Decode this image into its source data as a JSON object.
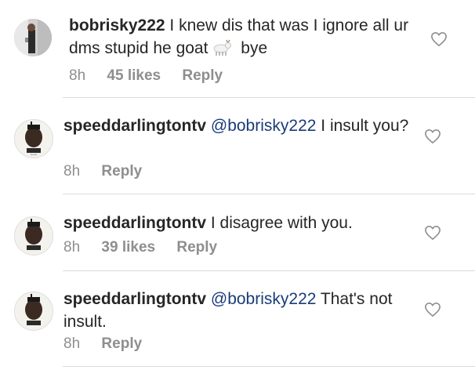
{
  "comments": [
    {
      "username": "bobrisky222",
      "text_before_emoji": "I knew dis that was I ignore all ur dms stupid he goat",
      "emoji": "goat-emoji",
      "text_after_emoji": "bye",
      "time": "8h",
      "likes": "45 likes",
      "reply": "Reply"
    },
    {
      "username": "speeddarlingtontv",
      "mention": "@bobrisky222",
      "text": "I insult you?",
      "time": "8h",
      "reply": "Reply"
    },
    {
      "username": "speeddarlingtontv",
      "text": "I disagree with you.",
      "time": "8h",
      "likes": "39 likes",
      "reply": "Reply"
    },
    {
      "username": "speeddarlingtontv",
      "mention": "@bobrisky222",
      "text": "That's not insult.",
      "time": "8h",
      "reply": "Reply"
    }
  ],
  "icons": {
    "like": "heart-outline-icon"
  },
  "colors": {
    "text": "#262626",
    "meta": "#8e8e8e",
    "mention": "#1a3b7a",
    "divider": "#dbdbdb"
  }
}
